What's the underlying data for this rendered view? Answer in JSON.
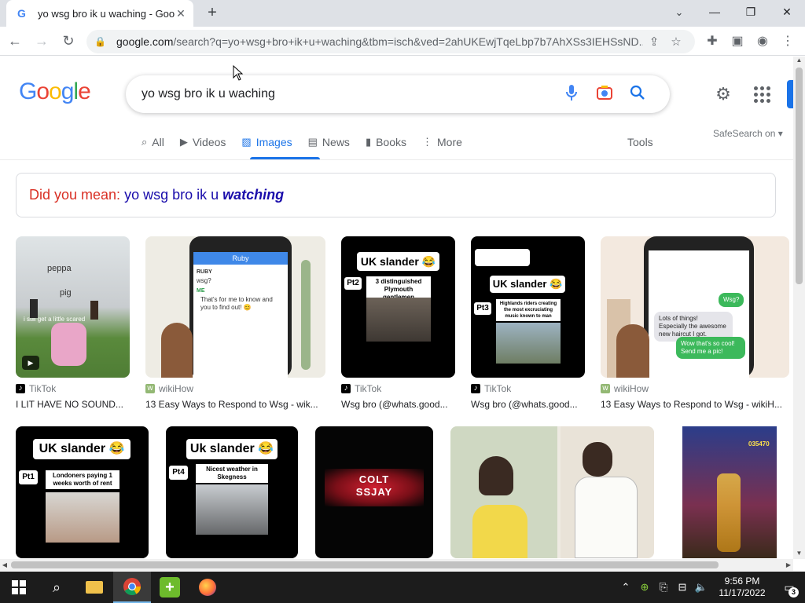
{
  "browser": {
    "tab_title": "yo wsg bro ik u waching - Google",
    "url_host": "google.com",
    "url_rest": "/search?q=yo+wsg+bro+ik+u+waching&tbm=isch&ved=2ahUKEwjTqeLbp7b7AhXSs3IEHSsND..."
  },
  "google": {
    "logo": [
      "G",
      "o",
      "o",
      "g",
      "l",
      "e"
    ],
    "query": "yo wsg bro ik u waching",
    "tabs": [
      {
        "label": "All",
        "icon": "search-icon"
      },
      {
        "label": "Videos",
        "icon": "video-icon"
      },
      {
        "label": "Images",
        "icon": "image-icon"
      },
      {
        "label": "News",
        "icon": "news-icon"
      },
      {
        "label": "Books",
        "icon": "book-icon"
      },
      {
        "label": "More",
        "icon": "more-vert-icon"
      }
    ],
    "tools_label": "Tools",
    "safesearch_label": "SafeSearch on",
    "did_you_mean": {
      "label": "Did you mean:",
      "prefix": "yo wsg bro ik u",
      "correction": "watching"
    }
  },
  "results": [
    {
      "source": "TikTok",
      "title": "I LIT HAVE NO SOUND...",
      "overlay": [
        "peppa",
        "pig",
        "i still get a little scared"
      ]
    },
    {
      "source": "wikiHow",
      "title": "13 Easy Ways to Respond to Wsg - wik...",
      "overlay": [
        "Ruby",
        "RUBY",
        "wsg?",
        "ME",
        "That's for me to know and you to find out! 😊"
      ]
    },
    {
      "source": "TikTok",
      "title": "Wsg bro (@whats.good...",
      "overlay": [
        "UK slander 😂",
        "Pt2",
        "3 distinguished Plymouth gentlemen"
      ]
    },
    {
      "source": "TikTok",
      "title": "Wsg bro (@whats.good...",
      "overlay": [
        "UK slander 😂",
        "Pt3",
        "Highlands riders creating the most excruciating music known to man"
      ]
    },
    {
      "source": "wikiHow",
      "title": "13 Easy Ways to Respond to Wsg - wikiH...",
      "overlay": [
        "Wsg?",
        "Lots of things! Especially the awesome new haircut I got.",
        "Wow that's so cool! Send me a pic!"
      ]
    },
    {
      "overlay": [
        "UK slander 😂",
        "Pt1",
        "Londoners paying 1 weeks worth of rent"
      ]
    },
    {
      "overlay": [
        "Uk slander 😂",
        "Pt4",
        "Nicest weather in Skegness"
      ]
    },
    {
      "overlay": [
        "COLT",
        "SSJAY"
      ]
    },
    {
      "overlay": []
    },
    {
      "overlay": [
        "035470"
      ]
    }
  ],
  "taskbar": {
    "time": "9:56 PM",
    "date": "11/17/2022",
    "notifications": "3"
  },
  "colors": {
    "accent": "#1a73e8",
    "link": "#1a0dab",
    "did_you_mean": "#d93025"
  }
}
